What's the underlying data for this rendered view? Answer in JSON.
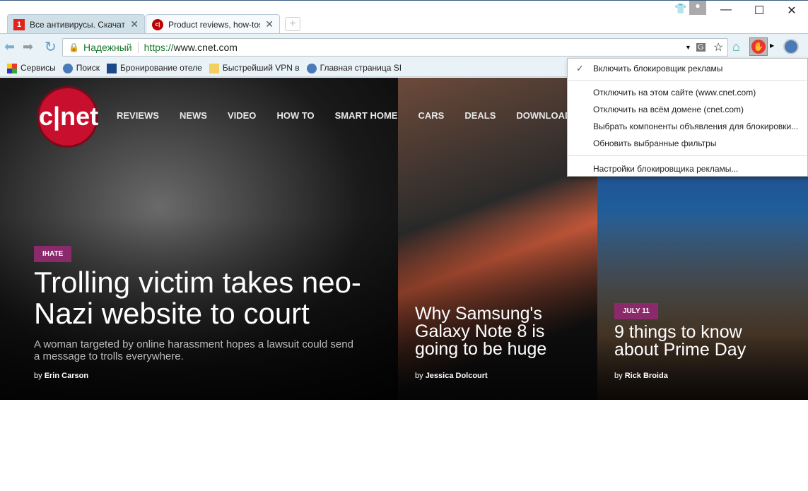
{
  "tabs": [
    {
      "label": "Все антивирусы. Скачать",
      "favicon": "1"
    },
    {
      "label": "Product reviews, how-tos",
      "favicon": "c|"
    }
  ],
  "window": {
    "minimize": "—",
    "maximize": "☐",
    "close": "✕"
  },
  "address": {
    "security_label": "Надежный",
    "url_scheme": "https://",
    "url_rest": "www.cnet.com"
  },
  "bookmarks": [
    "Сервисы",
    "Поиск",
    "Бронирование отеле",
    "Быстрейший VPN в",
    "Главная страница SI"
  ],
  "site": {
    "logo": "c|net",
    "nav": [
      "REVIEWS",
      "NEWS",
      "VIDEO",
      "HOW TO",
      "SMART HOME",
      "CARS",
      "DEALS",
      "DOWNLOAD"
    ]
  },
  "stories": [
    {
      "tag": "IHATE",
      "title": "Trolling victim takes neo-Nazi website to court",
      "summary": "A woman targeted by online harassment hopes a lawsuit could send a message to trolls everywhere.",
      "by": "by",
      "author": "Erin Carson"
    },
    {
      "title": "Why Samsung's Galaxy Note 8 is going to be huge",
      "by": "by",
      "author": "Jessica Dolcourt"
    },
    {
      "tag": "JULY 11",
      "title": "9 things to know about Prime Day",
      "by": "by",
      "author": "Rick Broida"
    }
  ],
  "menu": {
    "check": "✓",
    "items": [
      "Включить блокировщик рекламы",
      "Отключить на этом сайте (www.cnet.com)",
      "Отключить на всём домене (cnet.com)",
      "Выбрать компоненты объявления для блокировки...",
      "Обновить выбранные фильтры",
      "Настройки блокировщика рекламы..."
    ]
  }
}
